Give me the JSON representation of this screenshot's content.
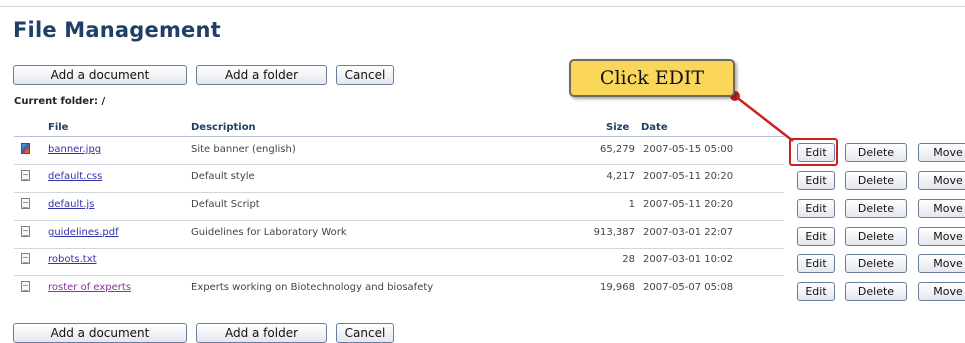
{
  "page": {
    "title": "File Management"
  },
  "toolbar": {
    "add_document": "Add a document",
    "add_folder": "Add a folder",
    "cancel": "Cancel"
  },
  "current_folder": "Current folder: /",
  "table": {
    "headers": {
      "file": "File",
      "description": "Description",
      "size": "Size",
      "date": "Date"
    },
    "action_labels": {
      "edit": "Edit",
      "delete": "Delete",
      "move": "Move"
    },
    "rows": [
      {
        "icon": "image-file-icon",
        "name": "banner.jpg",
        "description": "Site banner (english)",
        "size": "65,279",
        "date": "2007-05-15 05:00"
      },
      {
        "icon": "document-file-icon",
        "name": "default.css",
        "description": "Default style",
        "size": "4,217",
        "date": "2007-05-11 20:20"
      },
      {
        "icon": "document-file-icon",
        "name": "default.js",
        "description": "Default Script",
        "size": "1",
        "date": "2007-05-11 20:20"
      },
      {
        "icon": "document-file-icon",
        "name": "guidelines.pdf",
        "description": "Guidelines for Laboratory Work",
        "size": "913,387",
        "date": "2007-03-01 22:07"
      },
      {
        "icon": "document-file-icon",
        "name": "robots.txt",
        "description": "",
        "size": "28",
        "date": "2007-03-01 10:02"
      },
      {
        "icon": "document-file-icon",
        "name": "roster of experts",
        "description": "Experts working on Biotechnology and biosafety",
        "size": "19,968",
        "date": "2007-05-07 05:08"
      }
    ]
  },
  "callout": {
    "text": "Click EDIT"
  },
  "colors": {
    "title": "#1f3f66",
    "link": "#3333aa",
    "visited_link": "#883399",
    "callout_bg": "#fad75a",
    "highlight": "#cc1f1f"
  }
}
